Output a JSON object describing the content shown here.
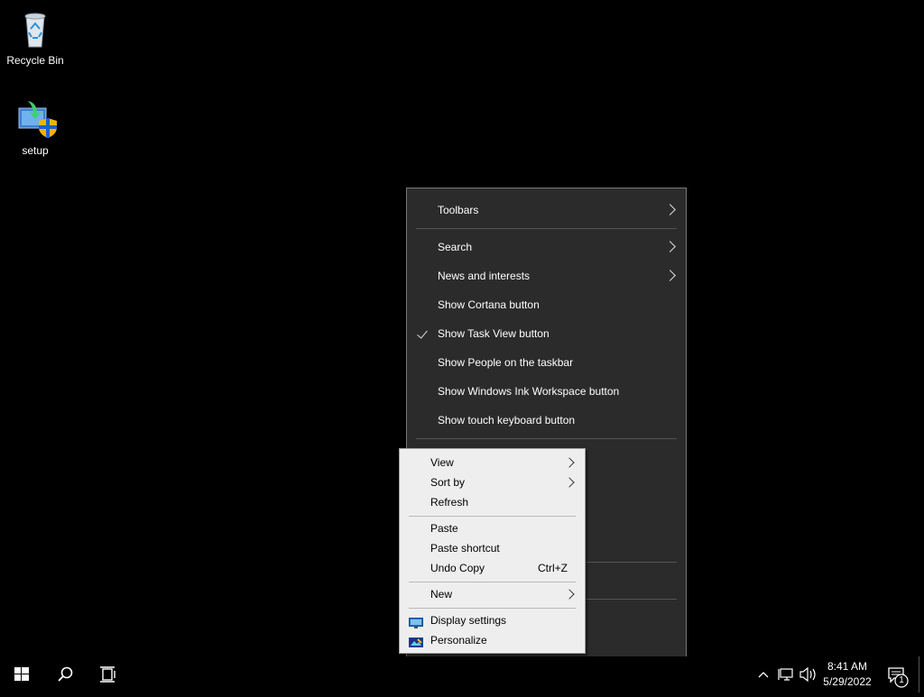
{
  "desktop": {
    "icons": [
      {
        "label": "Recycle Bin",
        "icon": "recycle-bin-icon"
      },
      {
        "label": "setup",
        "icon": "setup-installer-icon"
      }
    ]
  },
  "taskbar_menu": {
    "items": [
      {
        "label": "Toolbars",
        "submenu": true,
        "checked": false
      },
      {
        "label": "Search",
        "submenu": true,
        "checked": false
      },
      {
        "label": "News and interests",
        "submenu": true,
        "checked": false
      },
      {
        "label": "Show Cortana button",
        "submenu": false,
        "checked": false
      },
      {
        "label": "Show Task View button",
        "submenu": false,
        "checked": true
      },
      {
        "label": "Show People on the taskbar",
        "submenu": false,
        "checked": false
      },
      {
        "label": "Show Windows Ink Workspace button",
        "submenu": false,
        "checked": false
      },
      {
        "label": "Show touch keyboard button",
        "submenu": false,
        "checked": false
      }
    ]
  },
  "desktop_menu": {
    "items": [
      {
        "label": "View",
        "submenu": true
      },
      {
        "label": "Sort by",
        "submenu": true
      },
      {
        "label": "Refresh"
      },
      {
        "label": "Paste"
      },
      {
        "label": "Paste shortcut"
      },
      {
        "label": "Undo Copy",
        "shortcut": "Ctrl+Z"
      },
      {
        "label": "New",
        "submenu": true
      },
      {
        "label": "Display settings",
        "icon": "display-settings-icon"
      },
      {
        "label": "Personalize",
        "icon": "personalize-icon"
      }
    ]
  },
  "taskbar": {
    "start_icon": "windows-start-icon",
    "search_icon": "search-icon",
    "task_view_icon": "task-view-icon",
    "tray": {
      "time": "8:41 AM",
      "date": "5/29/2022",
      "notification_count": "1"
    }
  },
  "colors": {
    "desktop_bg": "#000000",
    "dark_menu_bg": "#2b2b2b",
    "light_menu_bg": "#eeeeee"
  }
}
